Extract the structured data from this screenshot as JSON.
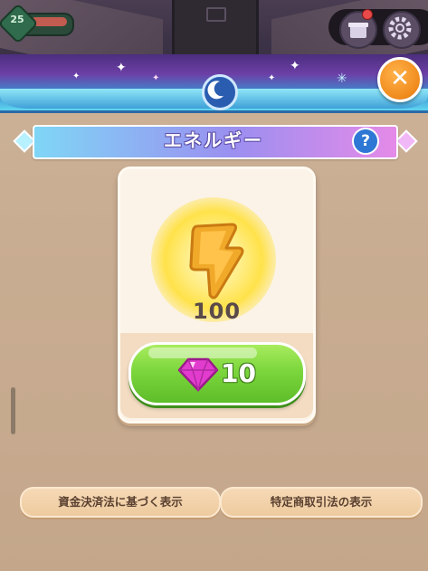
{
  "hud": {
    "level": "25"
  },
  "dialog": {
    "title": "エネルギー",
    "help_label": "?",
    "close_label": "✕"
  },
  "item": {
    "name": "energy",
    "amount": "100",
    "icon": "lightning-bolt-icon"
  },
  "purchase": {
    "currency_icon": "gem-icon",
    "price": "10",
    "colors": {
      "button": "#7cd63c",
      "gem": "#e23ccf"
    }
  },
  "footer": {
    "left_label": "資金決済法に基づく表示",
    "right_label": "特定商取引法の表示"
  },
  "colors": {
    "background": "#c9ad92",
    "accent_orange": "#f08a1c",
    "title_gradient_start": "#7fd6f6",
    "title_gradient_end": "#e58ae8"
  }
}
